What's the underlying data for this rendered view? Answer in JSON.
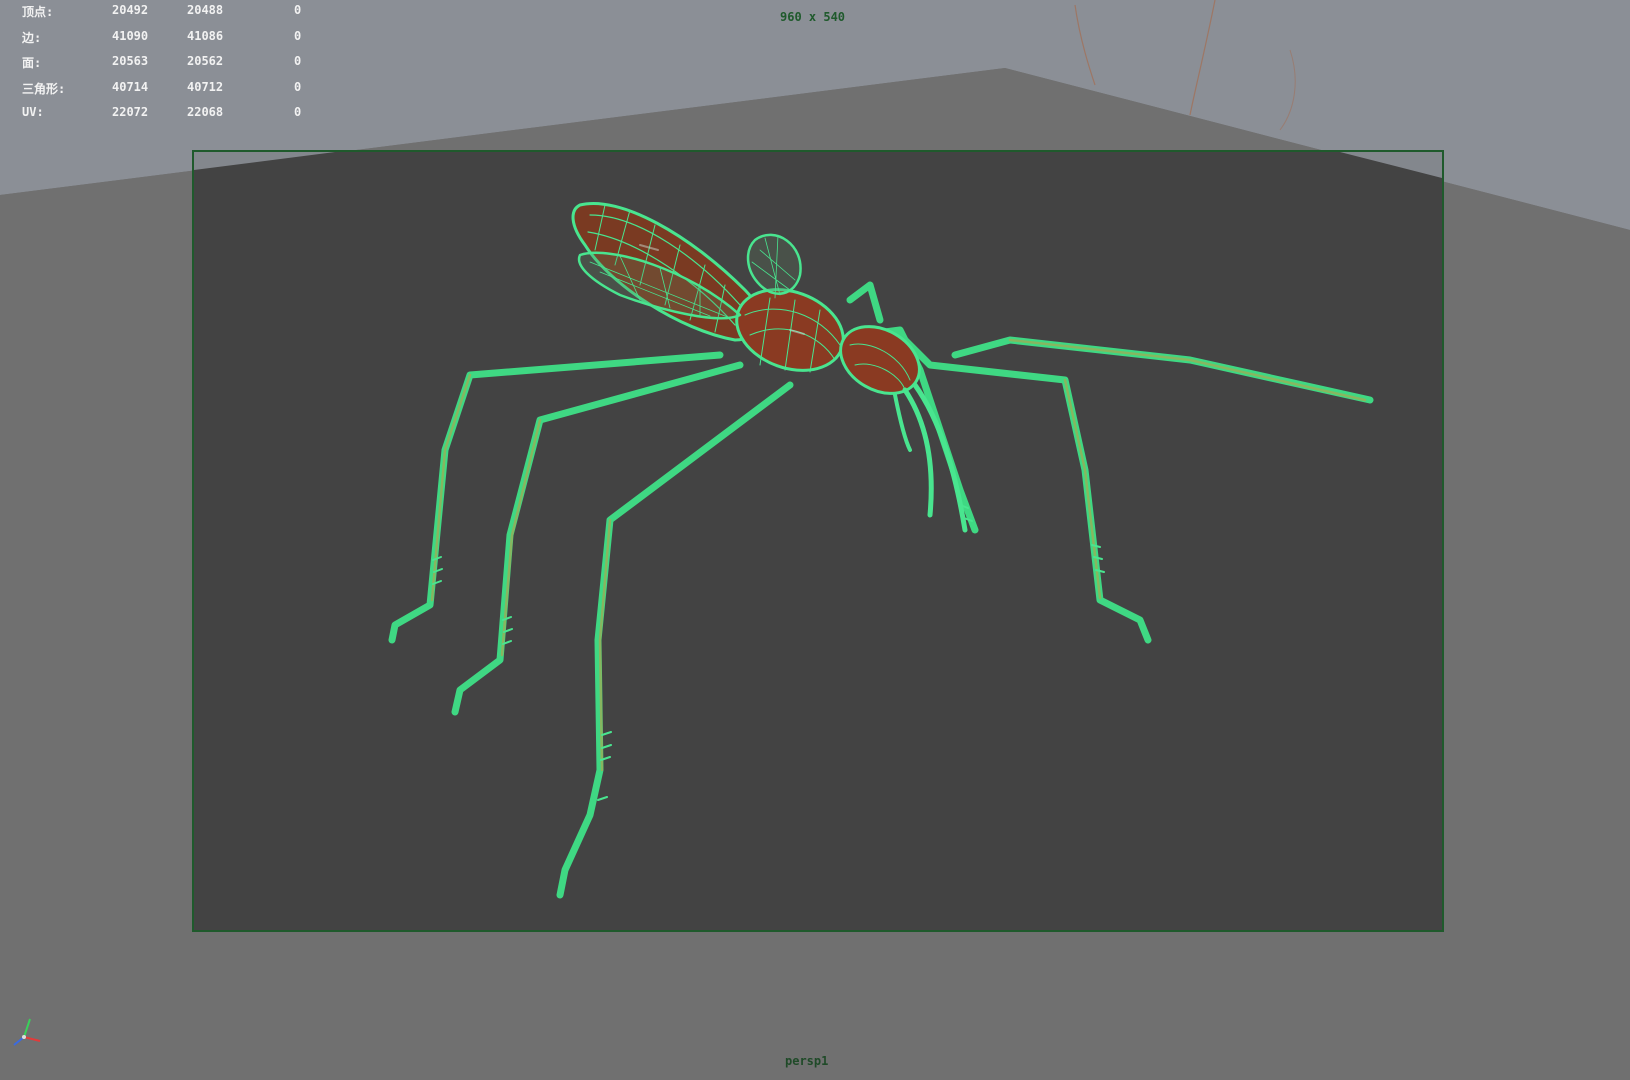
{
  "hud": {
    "rows": [
      {
        "label": "顶点:",
        "v1": "20492",
        "v2": "20488",
        "v3": "0"
      },
      {
        "label": "边:",
        "v1": "41090",
        "v2": "41086",
        "v3": "0"
      },
      {
        "label": "面:",
        "v1": "20563",
        "v2": "20562",
        "v3": "0"
      },
      {
        "label": "三角形:",
        "v1": "40714",
        "v2": "40712",
        "v3": "0"
      },
      {
        "label": "UV:",
        "v1": "22072",
        "v2": "22068",
        "v3": "0"
      }
    ]
  },
  "resolution_gate": "960 x 540",
  "camera": "persp1",
  "colors": {
    "background": "#6f6f6f",
    "gate_fill": "#434343",
    "gate_border": "#1f5a2c",
    "wireframe": "#49e58f",
    "body_shade": "#8a3a22",
    "hud_text": "#f2f2f2"
  },
  "icons": {
    "axis": "xyz-axis-icon"
  }
}
